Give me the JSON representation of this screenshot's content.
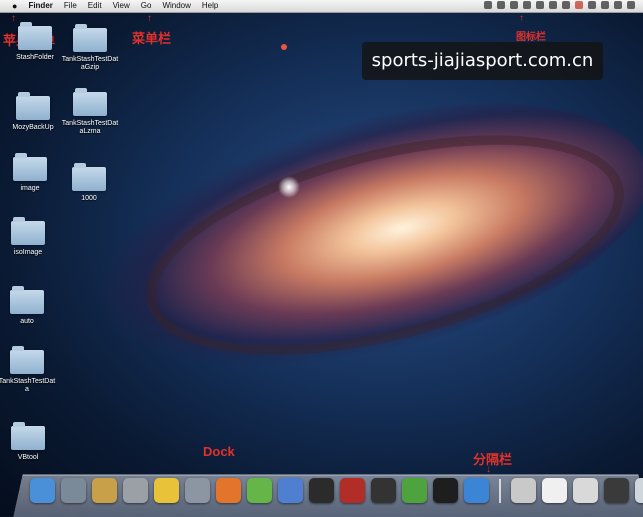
{
  "menubar": {
    "apple": "",
    "items": [
      "Finder",
      "File",
      "Edit",
      "View",
      "Go",
      "Window",
      "Help"
    ],
    "status_icons": [
      "status-icon-1",
      "status-icon-2",
      "status-icon-3",
      "status-icon-4",
      "status-icon-5",
      "status-icon-6",
      "status-icon-7",
      "status-icon-8",
      "status-icon-9"
    ],
    "clock": ""
  },
  "annotations": {
    "apple_menu": "苹果菜单",
    "menu_bar": "菜单栏",
    "status_bar": "图标栏",
    "dock": "Dock",
    "separator": "分隔栏"
  },
  "watermark": "sports-jiajiasport.com.cn",
  "desktop": {
    "icons": [
      {
        "label": "StashFolder"
      },
      {
        "label": "TankStashTestDataGzip"
      },
      {
        "label": "MozyBackUp"
      },
      {
        "label": "TankStashTestDataLzma"
      },
      {
        "label": "image"
      },
      {
        "label": "1000"
      },
      {
        "label": "isoImage"
      },
      {
        "label": "auto"
      },
      {
        "label": "TankStashTestData"
      },
      {
        "label": "VBtool"
      }
    ]
  },
  "dock": {
    "apps": [
      {
        "name": "finder-icon",
        "color": "#4a90d9"
      },
      {
        "name": "dashboard-icon",
        "color": "#7b8a99"
      },
      {
        "name": "keychain-icon",
        "color": "#c9a04a"
      },
      {
        "name": "disk-utility-icon",
        "color": "#9aa0a6"
      },
      {
        "name": "chrome-icon",
        "color": "#e8c33a"
      },
      {
        "name": "preview-icon",
        "color": "#8c96a3"
      },
      {
        "name": "firefox-icon",
        "color": "#e3742c"
      },
      {
        "name": "android-icon",
        "color": "#66b548"
      },
      {
        "name": "sync-icon",
        "color": "#4f7fd1"
      },
      {
        "name": "terminal-icon",
        "color": "#2b2b2b"
      },
      {
        "name": "filezilla-icon",
        "color": "#b22d27"
      },
      {
        "name": "console-icon",
        "color": "#333333"
      },
      {
        "name": "evernote-icon",
        "color": "#4fa33f"
      },
      {
        "name": "terminal2-icon",
        "color": "#1e1e1e"
      },
      {
        "name": "safari-icon",
        "color": "#3c85d6"
      }
    ],
    "stacks": [
      {
        "name": "printer-icon",
        "color": "#c9c9c9"
      },
      {
        "name": "document-icon",
        "color": "#f0f0f0"
      },
      {
        "name": "screenshot-icon",
        "color": "#d9d9d9"
      },
      {
        "name": "window-icon",
        "color": "#3a3a3a"
      },
      {
        "name": "trash-icon",
        "color": "#cfd6dc"
      }
    ]
  }
}
